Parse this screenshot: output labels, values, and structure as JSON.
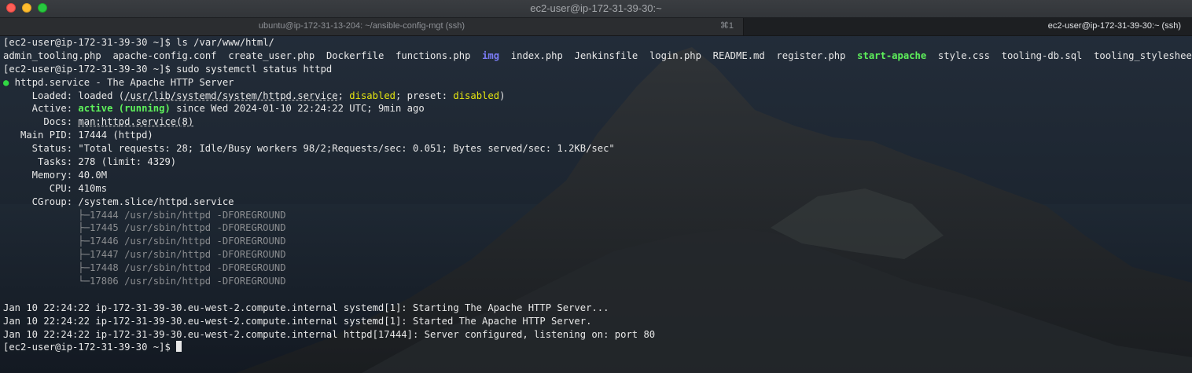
{
  "window": {
    "title": "ec2-user@ip-172-31-39-30:~"
  },
  "tabs": [
    {
      "label": "ubuntu@ip-172-31-13-204: ~/ansible-config-mgt (ssh)",
      "shortcut": "⌘1",
      "active": false
    },
    {
      "label": "ec2-user@ip-172-31-39-30:~ (ssh)",
      "active": true
    }
  ],
  "terminal": {
    "prompt": "[ec2-user@ip-172-31-39-30 ~]$",
    "cmd1": " ls /var/www/html/",
    "files": [
      {
        "name": "admin_tooling.php",
        "kind": "file"
      },
      {
        "name": "apache-config.conf",
        "kind": "file"
      },
      {
        "name": "create_user.php",
        "kind": "file"
      },
      {
        "name": "Dockerfile",
        "kind": "file"
      },
      {
        "name": "functions.php",
        "kind": "file"
      },
      {
        "name": "img",
        "kind": "dir"
      },
      {
        "name": "index.php",
        "kind": "file"
      },
      {
        "name": "Jenkinsfile",
        "kind": "file"
      },
      {
        "name": "login.php",
        "kind": "file"
      },
      {
        "name": "README.md",
        "kind": "file"
      },
      {
        "name": "register.php",
        "kind": "file"
      },
      {
        "name": "start-apache",
        "kind": "exec"
      },
      {
        "name": "style.css",
        "kind": "file"
      },
      {
        "name": "tooling-db.sql",
        "kind": "file"
      },
      {
        "name": "tooling_stylesheets.css",
        "kind": "file"
      }
    ],
    "cmd2": " sudo systemctl status httpd",
    "status": {
      "dot": "●",
      "unit_line": " httpd.service - The Apache HTTP Server",
      "loaded_label": "     Loaded:",
      "loaded_pre": " loaded (",
      "loaded_path": "/usr/lib/systemd/system/httpd.service",
      "loaded_sep1": "; ",
      "loaded_state": "disabled",
      "loaded_sep2": "; preset: ",
      "loaded_preset": "disabled",
      "loaded_post": ")",
      "active_label": "     Active:",
      "active_state": " active (running)",
      "active_since": " since Wed 2024-01-10 22:24:22 UTC; 9min ago",
      "docs_label": "       Docs:",
      "docs_link": "man:httpd.service(8)",
      "mainpid_line": "   Main PID: 17444 (httpd)",
      "status_line": "     Status: \"Total requests: 28; Idle/Busy workers 98/2;Requests/sec: 0.051; Bytes served/sec: 1.2KB/sec\"",
      "tasks_line": "      Tasks: 278 (limit: 4329)",
      "memory_line": "     Memory: 40.0M",
      "cpu_line": "        CPU: 410ms",
      "cgroup_line": "     CGroup: /system.slice/httpd.service",
      "processes": [
        "             ├─17444 /usr/sbin/httpd -DFOREGROUND",
        "             ├─17445 /usr/sbin/httpd -DFOREGROUND",
        "             ├─17446 /usr/sbin/httpd -DFOREGROUND",
        "             ├─17447 /usr/sbin/httpd -DFOREGROUND",
        "             ├─17448 /usr/sbin/httpd -DFOREGROUND",
        "             └─17806 /usr/sbin/httpd -DFOREGROUND"
      ]
    },
    "journal": [
      "Jan 10 22:24:22 ip-172-31-39-30.eu-west-2.compute.internal systemd[1]: Starting The Apache HTTP Server...",
      "Jan 10 22:24:22 ip-172-31-39-30.eu-west-2.compute.internal systemd[1]: Started The Apache HTTP Server.",
      "Jan 10 22:24:22 ip-172-31-39-30.eu-west-2.compute.internal httpd[17444]: Server configured, listening on: port 80"
    ]
  },
  "colors": {
    "directory": "#7b7cf5",
    "executable": "#5ef15b",
    "active_running": "#5ef15b",
    "disabled": "#e5e510",
    "status_dot": "#31d843"
  }
}
